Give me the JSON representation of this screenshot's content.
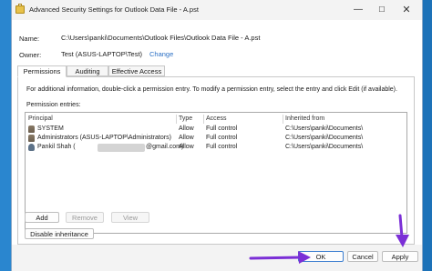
{
  "window": {
    "title": "Advanced Security Settings for Outlook Data File - A.pst",
    "minimize_glyph": "—",
    "maximize_glyph": "☐",
    "close_glyph": "✕"
  },
  "object": {
    "name_label": "Name:",
    "name_value": "C:\\Users\\panki\\Documents\\Outlook Files\\Outlook Data File - A.pst",
    "owner_label": "Owner:",
    "owner_value": "Test (ASUS-LAPTOP\\Test)",
    "change_label": "Change"
  },
  "tabs": [
    {
      "label": "Permissions",
      "active": true
    },
    {
      "label": "Auditing",
      "active": false
    },
    {
      "label": "Effective Access",
      "active": false
    }
  ],
  "permissions": {
    "info_text": "For additional information, double-click a permission entry. To modify a permission entry, select the entry and click Edit (if available).",
    "entries_label": "Permission entries:",
    "columns": [
      "Principal",
      "Type",
      "Access",
      "Inherited from"
    ],
    "rows": [
      {
        "principal": "SYSTEM",
        "type": "Allow",
        "access": "Full control",
        "inherited_from": "C:\\Users\\panki\\Documents\\",
        "icon": "users-icon"
      },
      {
        "principal": "Administrators (ASUS-LAPTOP\\Administrators)",
        "type": "Allow",
        "access": "Full control",
        "inherited_from": "C:\\Users\\panki\\Documents\\",
        "icon": "users-icon"
      },
      {
        "principal_prefix": "Pankil Shah (",
        "principal_suffix": "@gmail.com)",
        "type": "Allow",
        "access": "Full control",
        "inherited_from": "C:\\Users\\panki\\Documents\\",
        "icon": "user-icon"
      }
    ],
    "add_label": "Add",
    "remove_label": "Remove",
    "view_label": "View",
    "disable_inheritance_label": "Disable inheritance"
  },
  "footer": {
    "ok_label": "OK",
    "cancel_label": "Cancel",
    "apply_label": "Apply"
  },
  "colors": {
    "annotation_arrow": "#7b2fd6",
    "link": "#2a6fc4"
  }
}
